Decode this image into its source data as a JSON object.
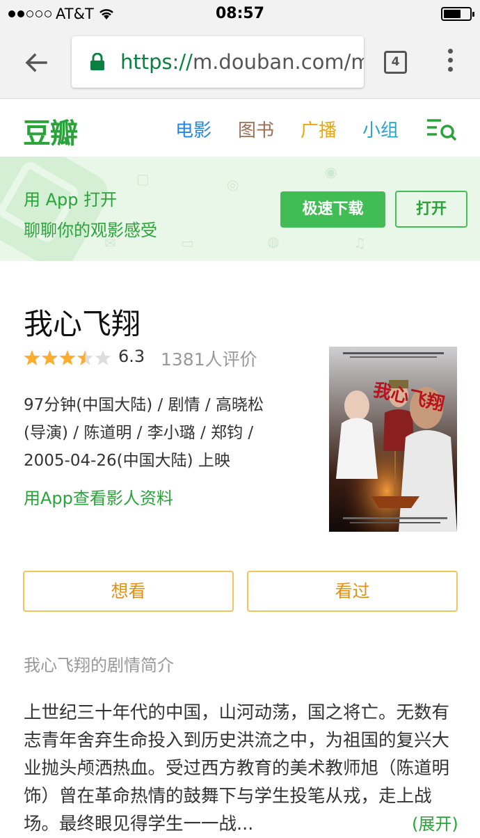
{
  "status_bar": {
    "carrier": "AT&T",
    "time": "08:57"
  },
  "browser": {
    "url_scheme": "https://",
    "url_rest": "m.douban.com/mo",
    "tab_count": "4"
  },
  "nav": {
    "logo": "豆瓣",
    "links": [
      {
        "label": "电影",
        "color": "#2384e8"
      },
      {
        "label": "图书",
        "color": "#9c6e52"
      },
      {
        "label": "广播",
        "color": "#e4a813"
      },
      {
        "label": "小组",
        "color": "#2aa3c8"
      }
    ]
  },
  "banner": {
    "title": "用 App 打开",
    "subtitle": "聊聊你的观影感受",
    "download_label": "极速下载",
    "open_label": "打开"
  },
  "movie": {
    "title": "我心飞翔",
    "rating": "6.3",
    "stars_out_of_5": 3.5,
    "votes": "1381人评价",
    "meta_lines": [
      "97分钟(中国大陆) / 剧情 / 高晓松",
      "(导演) / 陈道明 / 李小璐 / 郑钧 /",
      "2005-04-26(中国大陆) 上映"
    ],
    "app_link": "用App查看影人资料",
    "poster_title_art": "我心飞翔"
  },
  "actions": {
    "want": "想看",
    "seen": "看过"
  },
  "synopsis": {
    "heading": "我心飞翔的剧情简介",
    "text": "上世纪三十年代的中国，山河动荡，国之将亡。无数有志青年舍弃生命投入到历史洪流之中，为祖国的复兴大业抛头颅洒热血。受过西方教育的美术教师旭（陈道明 饰）曾在革命热情的鼓舞下与学生投笔从戎，走上战场。最终眼见得学生一一战...",
    "more": "(展开)"
  },
  "colors": {
    "brand_green": "#42bd56",
    "star": "#ffac2d",
    "button_yellow": "#f3c35c"
  }
}
